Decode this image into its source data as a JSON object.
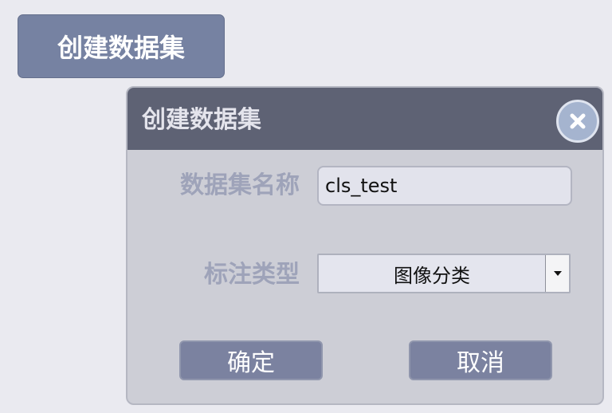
{
  "toolbar": {
    "create_dataset_label": "创建数据集"
  },
  "dialog": {
    "title": "创建数据集",
    "close_icon": "close-x-icon",
    "fields": {
      "name_label": "数据集名称",
      "name_value": "cls_test",
      "type_label": "标注类型",
      "type_value": "图像分类"
    },
    "ok_label": "确定",
    "cancel_label": "取消"
  },
  "colors": {
    "page_bg": "#eaeaf0",
    "button_accent": "#7682a2",
    "dialog_header": "#5e6274",
    "dialog_body": "#cdced6",
    "label_text": "#9ea3b9",
    "close_circle": "#a5b4cf"
  }
}
